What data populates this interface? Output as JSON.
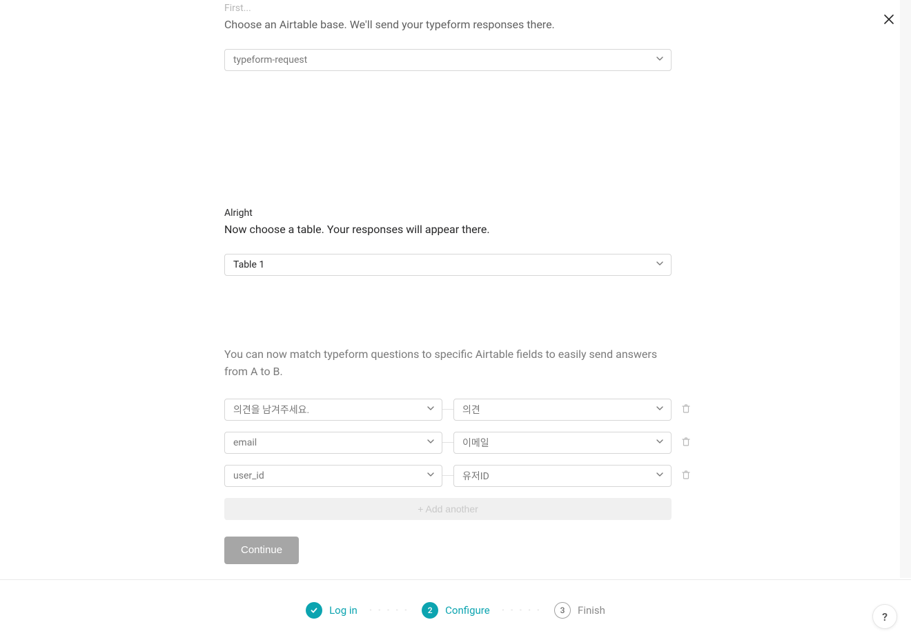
{
  "close_label": "×",
  "section_base": {
    "eyebrow": "First...",
    "heading": "Choose an Airtable base. We'll send your typeform responses there.",
    "selected": "typeform-request"
  },
  "section_table": {
    "eyebrow": "Alright",
    "heading": "Now choose a table. Your responses will appear there.",
    "selected": "Table 1"
  },
  "section_match": {
    "paragraph": "You can now match typeform questions to specific Airtable fields to easily send answers from A to B.",
    "rows": [
      {
        "left": "의견을 남겨주세요.",
        "right": "의견"
      },
      {
        "left": "email",
        "right": "이메일"
      },
      {
        "left": "user_id",
        "right": "유저ID"
      }
    ],
    "add_label": "+ Add another"
  },
  "continue_label": "Continue",
  "stepper": {
    "step1": {
      "label": "Log in"
    },
    "step2": {
      "num": "2",
      "label": "Configure"
    },
    "step3": {
      "num": "3",
      "label": "Finish"
    }
  },
  "help_label": "?"
}
